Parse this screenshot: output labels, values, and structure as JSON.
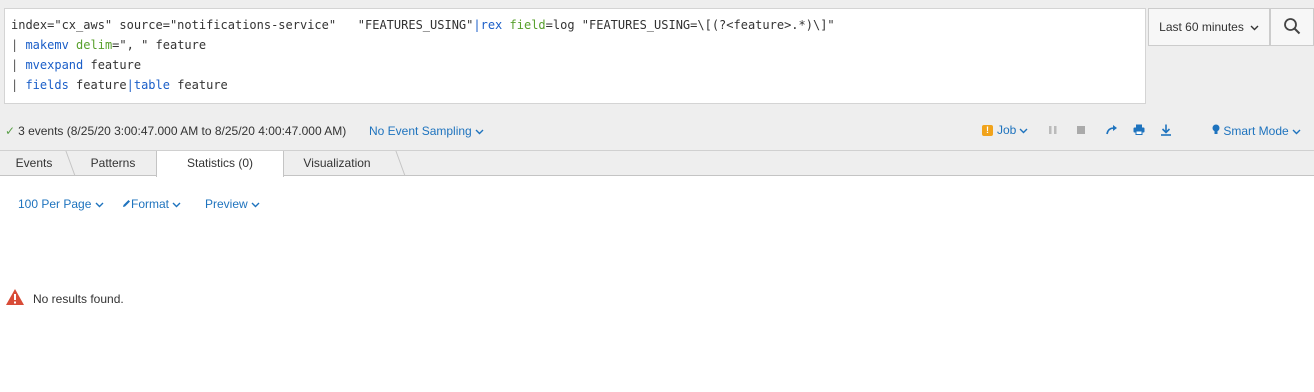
{
  "search": {
    "line1": {
      "prefix": "index=\"cx_aws\" source=\"notifications-service\"   \"FEATURES_USING\"",
      "pipe": "|",
      "cmd": "rex",
      "arg": "field",
      "rest": "=log \"FEATURES_USING=\\[(?<feature>.*)\\]\""
    },
    "line2": {
      "pipe": "| ",
      "cmd": "makemv",
      "arg": "delim",
      "rest": "=\", \" feature"
    },
    "line3": {
      "pipe": "| ",
      "cmd": "mvexpand",
      "rest": " feature"
    },
    "line4": {
      "pipe": "| ",
      "cmd": "fields",
      "rest": " feature",
      "pipe2": "|",
      "cmd2": "table",
      "rest2": " feature"
    }
  },
  "time_picker": {
    "label": "Last 60 minutes"
  },
  "status": {
    "summary": "3 events (8/25/20 3:00:47.000 AM to 8/25/20 4:00:47.000 AM)",
    "sampling": "No Event Sampling",
    "job": "Job",
    "job_warn": "!",
    "mode": "Smart Mode"
  },
  "tabs": [
    {
      "label": "Events"
    },
    {
      "label": "Patterns"
    },
    {
      "label": "Statistics (0)"
    },
    {
      "label": "Visualization"
    }
  ],
  "toolbar": {
    "per_page": "100 Per Page",
    "format": "Format",
    "preview": "Preview"
  },
  "message": {
    "text": "No results found."
  },
  "colors": {
    "link": "#1e73be",
    "command": "#1a5ec8",
    "argument": "#58a02c",
    "warning": "#d84c38",
    "job_warning": "#f1a31b",
    "success": "#5ba04a"
  },
  "icons": [
    "search-icon",
    "chevron-down-icon",
    "check-icon",
    "warning-icon",
    "pause-icon",
    "stop-icon",
    "share-icon",
    "print-icon",
    "export-icon",
    "bulb-icon",
    "pencil-icon",
    "alert-triangle-icon"
  ]
}
